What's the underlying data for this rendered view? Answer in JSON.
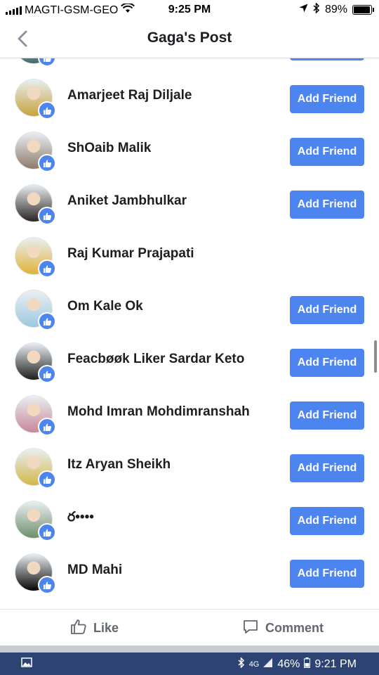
{
  "status_bar": {
    "carrier": "MAGTI-GSM-GEO",
    "time": "9:25 PM",
    "battery_percent": "89%",
    "battery_level": 0.89
  },
  "nav": {
    "title": "Gaga's Post"
  },
  "people": [
    {
      "name": "",
      "button": "Add Friend",
      "avatar_color": "#3f6b6d"
    },
    {
      "name": "Amarjeet Raj Diljale",
      "button": "Add Friend",
      "avatar_color": "#c8a23b"
    },
    {
      "name": "ShOaib Malik",
      "button": "Add Friend",
      "avatar_color": "#8d7b6a"
    },
    {
      "name": "Aniket Jambhulkar",
      "button": "Add Friend",
      "avatar_color": "#2a2523"
    },
    {
      "name": "Raj Kumar Prajapati",
      "button": "",
      "avatar_color": "#e0b23a"
    },
    {
      "name": "Om Kale Ok",
      "button": "Add Friend",
      "avatar_color": "#9cc9de"
    },
    {
      "name": "Feacbøøk Liker Sardar Keto",
      "button": "Add Friend",
      "avatar_color": "#1d1f1d"
    },
    {
      "name": "Mohd Imran Mohdimranshah",
      "button": "Add Friend",
      "avatar_color": "#c9869a"
    },
    {
      "name": "Itz Aryan Sheikh",
      "button": "Add Friend",
      "avatar_color": "#d4b74a"
    },
    {
      "name": "ర••••",
      "button": "Add Friend",
      "avatar_color": "#6f8f6a"
    },
    {
      "name": "MD Mahi",
      "button": "Add Friend",
      "avatar_color": "#050505"
    }
  ],
  "actions": {
    "like": "Like",
    "comment": "Comment"
  },
  "android_bar": {
    "network": "4G",
    "battery": "46%",
    "time": "9:21 PM"
  },
  "colors": {
    "accent": "#4c84f0",
    "android_bar": "#2d4373"
  }
}
